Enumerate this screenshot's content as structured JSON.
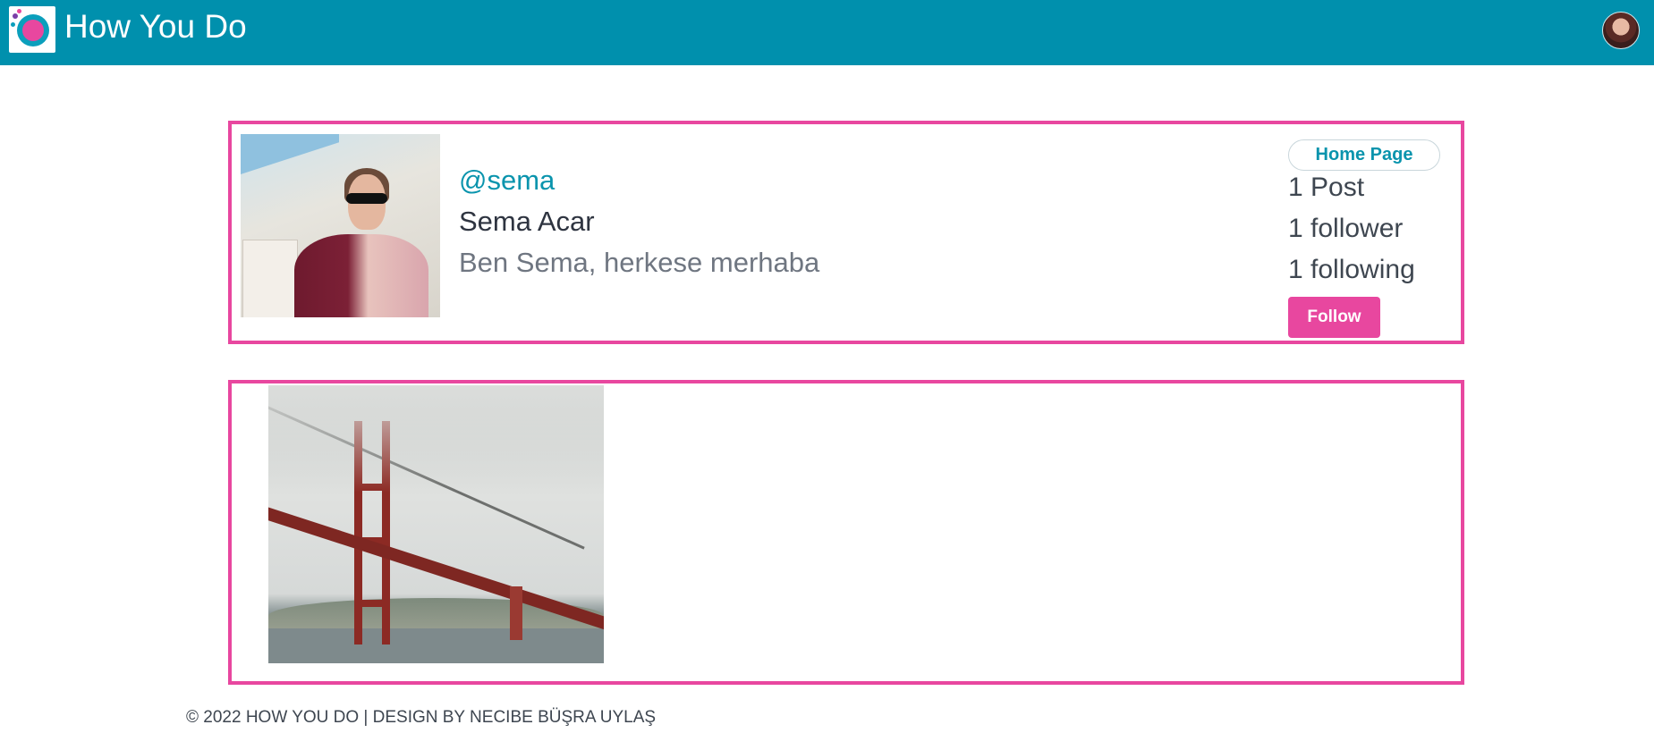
{
  "navbar": {
    "brand": "How You Do",
    "logo_icon": "how-you-do-logo",
    "avatar_icon": "user-avatar"
  },
  "profile": {
    "username": "@sema",
    "full_name": "Sema Acar",
    "bio": "Ben Sema, herkese merhaba",
    "home_page_label": "Home Page",
    "posts_count": "1 Post",
    "followers_count": "1 follower",
    "following_count": "1 following",
    "follow_label": "Follow"
  },
  "posts": [
    {
      "image": "golden-gate-bridge-photo"
    }
  ],
  "footer": {
    "text": "© 2022 HOW YOU DO | DESIGN BY NECIBE BÜŞRA UYLAŞ"
  },
  "colors": {
    "navbar": "#0090ad",
    "accent_pink": "#e8479f",
    "link_teal": "#0a94ad"
  }
}
